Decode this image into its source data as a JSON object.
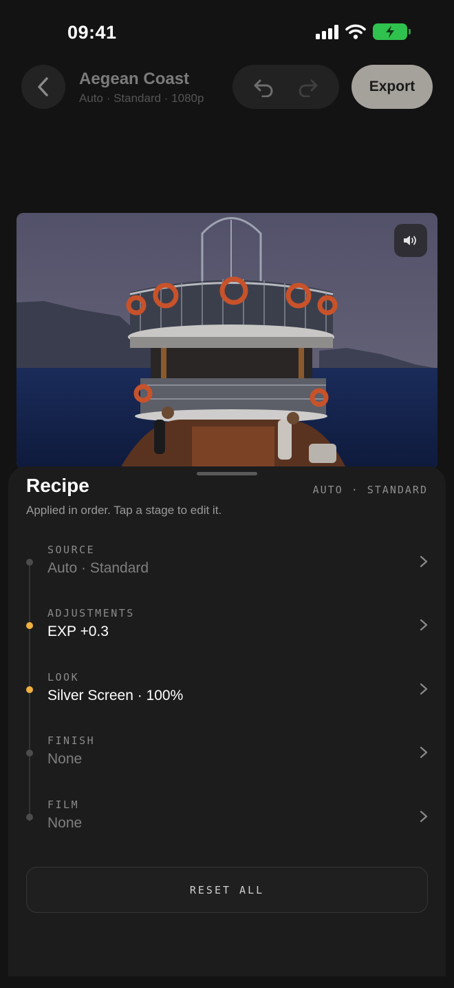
{
  "status": {
    "time": "09:41"
  },
  "header": {
    "title": "Aegean Coast",
    "subtitle": "Auto · Standard · 1080p",
    "export_label": "Export"
  },
  "icons": {
    "back": "chevron-left-icon",
    "undo": "undo-icon",
    "redo": "redo-icon",
    "mute": "speaker-icon",
    "stage_chevron": "chevron-right-icon"
  },
  "sheet": {
    "title": "Recipe",
    "meta_mode": "AUTO",
    "meta_sep": "·",
    "meta_profile": "STANDARD",
    "description": "Applied in order. Tap a stage to edit it.",
    "stages": [
      {
        "label": "SOURCE",
        "value": "Auto · Standard",
        "active": false
      },
      {
        "label": "ADJUSTMENTS",
        "value": "EXP +0.3",
        "active": true
      },
      {
        "label": "LOOK",
        "value": "Silver Screen · 100%",
        "active": true
      },
      {
        "label": "FINISH",
        "value": "None",
        "active": false
      },
      {
        "label": "FILM",
        "value": "None",
        "active": false
      }
    ],
    "reset_label": "RESET ALL"
  },
  "colors": {
    "active_dot": "#f0b03e",
    "battery": "#30c24e",
    "export_button": "#a5a29c"
  }
}
